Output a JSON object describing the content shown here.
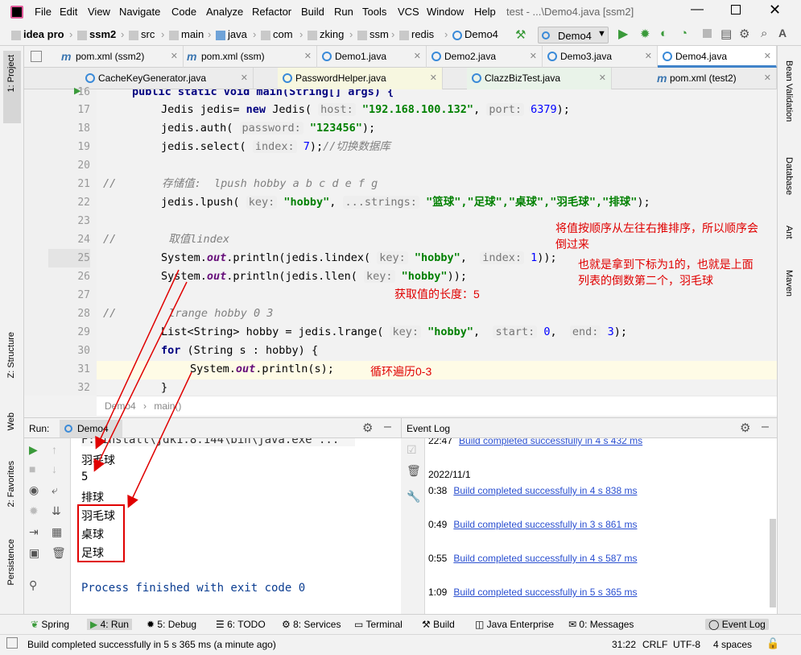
{
  "app": {
    "title": "test - ...\\Demo4.java [ssm2]",
    "menu": [
      "File",
      "Edit",
      "View",
      "Navigate",
      "Code",
      "Analyze",
      "Refactor",
      "Build",
      "Run",
      "Tools",
      "VCS",
      "Window",
      "Help"
    ]
  },
  "breadcrumb": [
    "idea pro",
    "ssm2",
    "src",
    "main",
    "java",
    "com",
    "zking",
    "ssm",
    "redis",
    "Demo4"
  ],
  "run_config": "Demo4",
  "tabs_row1": [
    {
      "label": "pom.xml (ssm2)"
    },
    {
      "label": "pom.xml (ssm)"
    },
    {
      "label": "Demo1.java"
    },
    {
      "label": "Demo2.java"
    },
    {
      "label": "Demo3.java"
    },
    {
      "label": "Demo4.java"
    }
  ],
  "tabs_row2": [
    {
      "label": "CacheKeyGenerator.java"
    },
    {
      "label": "PasswordHelper.java"
    },
    {
      "label": "ClazzBizTest.java"
    },
    {
      "label": "pom.xml (test2)"
    }
  ],
  "left_tools": [
    "1: Project",
    "Z: Structure",
    "Web",
    "2: Favorites",
    "Persistence"
  ],
  "right_tools": [
    "Bean Validation",
    "Database",
    "Ant",
    "Maven"
  ],
  "line_numbers": [
    "16",
    "17",
    "18",
    "19",
    "20",
    "21",
    "22",
    "23",
    "24",
    "25",
    "26",
    "27",
    "28",
    "29",
    "30",
    "31",
    "32"
  ],
  "code": {
    "l16": "public static void main(String[] args) {",
    "l17a": "Jedis jedis= ",
    "l17b": "new ",
    "l17c": "Jedis(",
    "l17h": "host:",
    "l17s": "\"192.168.100.132\"",
    "l17d": ",",
    "l17p": "port:",
    "l17n": "6379",
    "l17e": ");",
    "l18a": "jedis.auth(",
    "l18h": "password:",
    "l18s": "\"123456\"",
    "l18e": ");",
    "l19a": "jedis.select(",
    "l19h": "index:",
    "l19n": "7",
    "l19e": ");",
    "l19c": "//切换数据库",
    "l21a": "//",
    "l21c": "存储值:  lpush hobby a b c d e f g",
    "l22a": "jedis.lpush(",
    "l22h": "key:",
    "l22s": "\"hobby\"",
    "l22d": ",",
    "l22h2": "...strings:",
    "l22v": "\"篮球\",\"足球\",\"桌球\",\"羽毛球\",\"排球\"",
    "l22e": ");",
    "l24a": "//",
    "l24c": "取值lindex",
    "l25a": "System.",
    "l25f": "out",
    "l25b": ".println(jedis.lindex(",
    "l25h": "key:",
    "l25s": "\"hobby\"",
    "l25d": ",",
    "l25h2": "index:",
    "l25n": "1",
    "l25e": "));",
    "l26a": "System.",
    "l26f": "out",
    "l26b": ".println(jedis.llen(",
    "l26h": "key:",
    "l26s": "\"hobby\"",
    "l26e": "));",
    "l28a": "//",
    "l28c": "lrange hobby 0 3",
    "l29a": "List<String> hobby = jedis.lrange(",
    "l29h": "key:",
    "l29s": "\"hobby\"",
    "l29d": ",",
    "l29h2": "start:",
    "l29n": "0",
    "l29d2": ",",
    "l29h3": "end:",
    "l29n2": "3",
    "l29e": ");",
    "l30a": "for ",
    "l30b": "(String s : hobby) {",
    "l31a": "System.",
    "l31f": "out",
    "l31b": ".println(s);",
    "l32": "}"
  },
  "annotations": {
    "a1": "将值按顺序从左往右推排序，所以顺序会",
    "a1b": "倒过来",
    "a2": "也就是拿到下标为1的，也就是上面",
    "a2b": "列表的倒数第二个，羽毛球",
    "a3": "获取值的长度：5",
    "a4": "循环遍历0-3"
  },
  "editor_breadcrumb": [
    "Demo4",
    "main()"
  ],
  "run_panel": {
    "label": "Run:",
    "tab": "Demo4"
  },
  "console": [
    "F:\\install\\jdk1.8.144\\bin\\java.exe ...",
    "羽毛球",
    "5",
    "排球",
    "羽毛球",
    "桌球",
    "足球",
    "",
    "Process finished with exit code 0"
  ],
  "event_log": {
    "title": "Event Log",
    "entries": [
      {
        "time": "22:47",
        "msg": "Build completed successfully in 4 s 432 ms"
      },
      {
        "time": "2022/11/1",
        "msg": ""
      },
      {
        "time": "0:38",
        "msg": "Build completed successfully in 4 s 838 ms"
      },
      {
        "time": "0:49",
        "msg": "Build completed successfully in 3 s 861 ms"
      },
      {
        "time": "0:55",
        "msg": "Build completed successfully in 4 s 587 ms"
      },
      {
        "time": "1:09",
        "msg": "Build completed successfully in 5 s 365 ms"
      }
    ]
  },
  "bottom_tools": [
    "Spring",
    "4: Run",
    "5: Debug",
    "6: TODO",
    "8: Services",
    "Terminal",
    "Build",
    "Java Enterprise",
    "0: Messages",
    "Event Log"
  ],
  "status": {
    "message": "Build completed successfully in 5 s 365 ms (a minute ago)",
    "position": "31:22",
    "line_sep": "CRLF",
    "encoding": "UTF-8",
    "indent": "4 spaces"
  },
  "colors": {
    "accent": "#4083c9",
    "annotation": "#e00000",
    "string": "#008000",
    "keyword": "#000080"
  }
}
